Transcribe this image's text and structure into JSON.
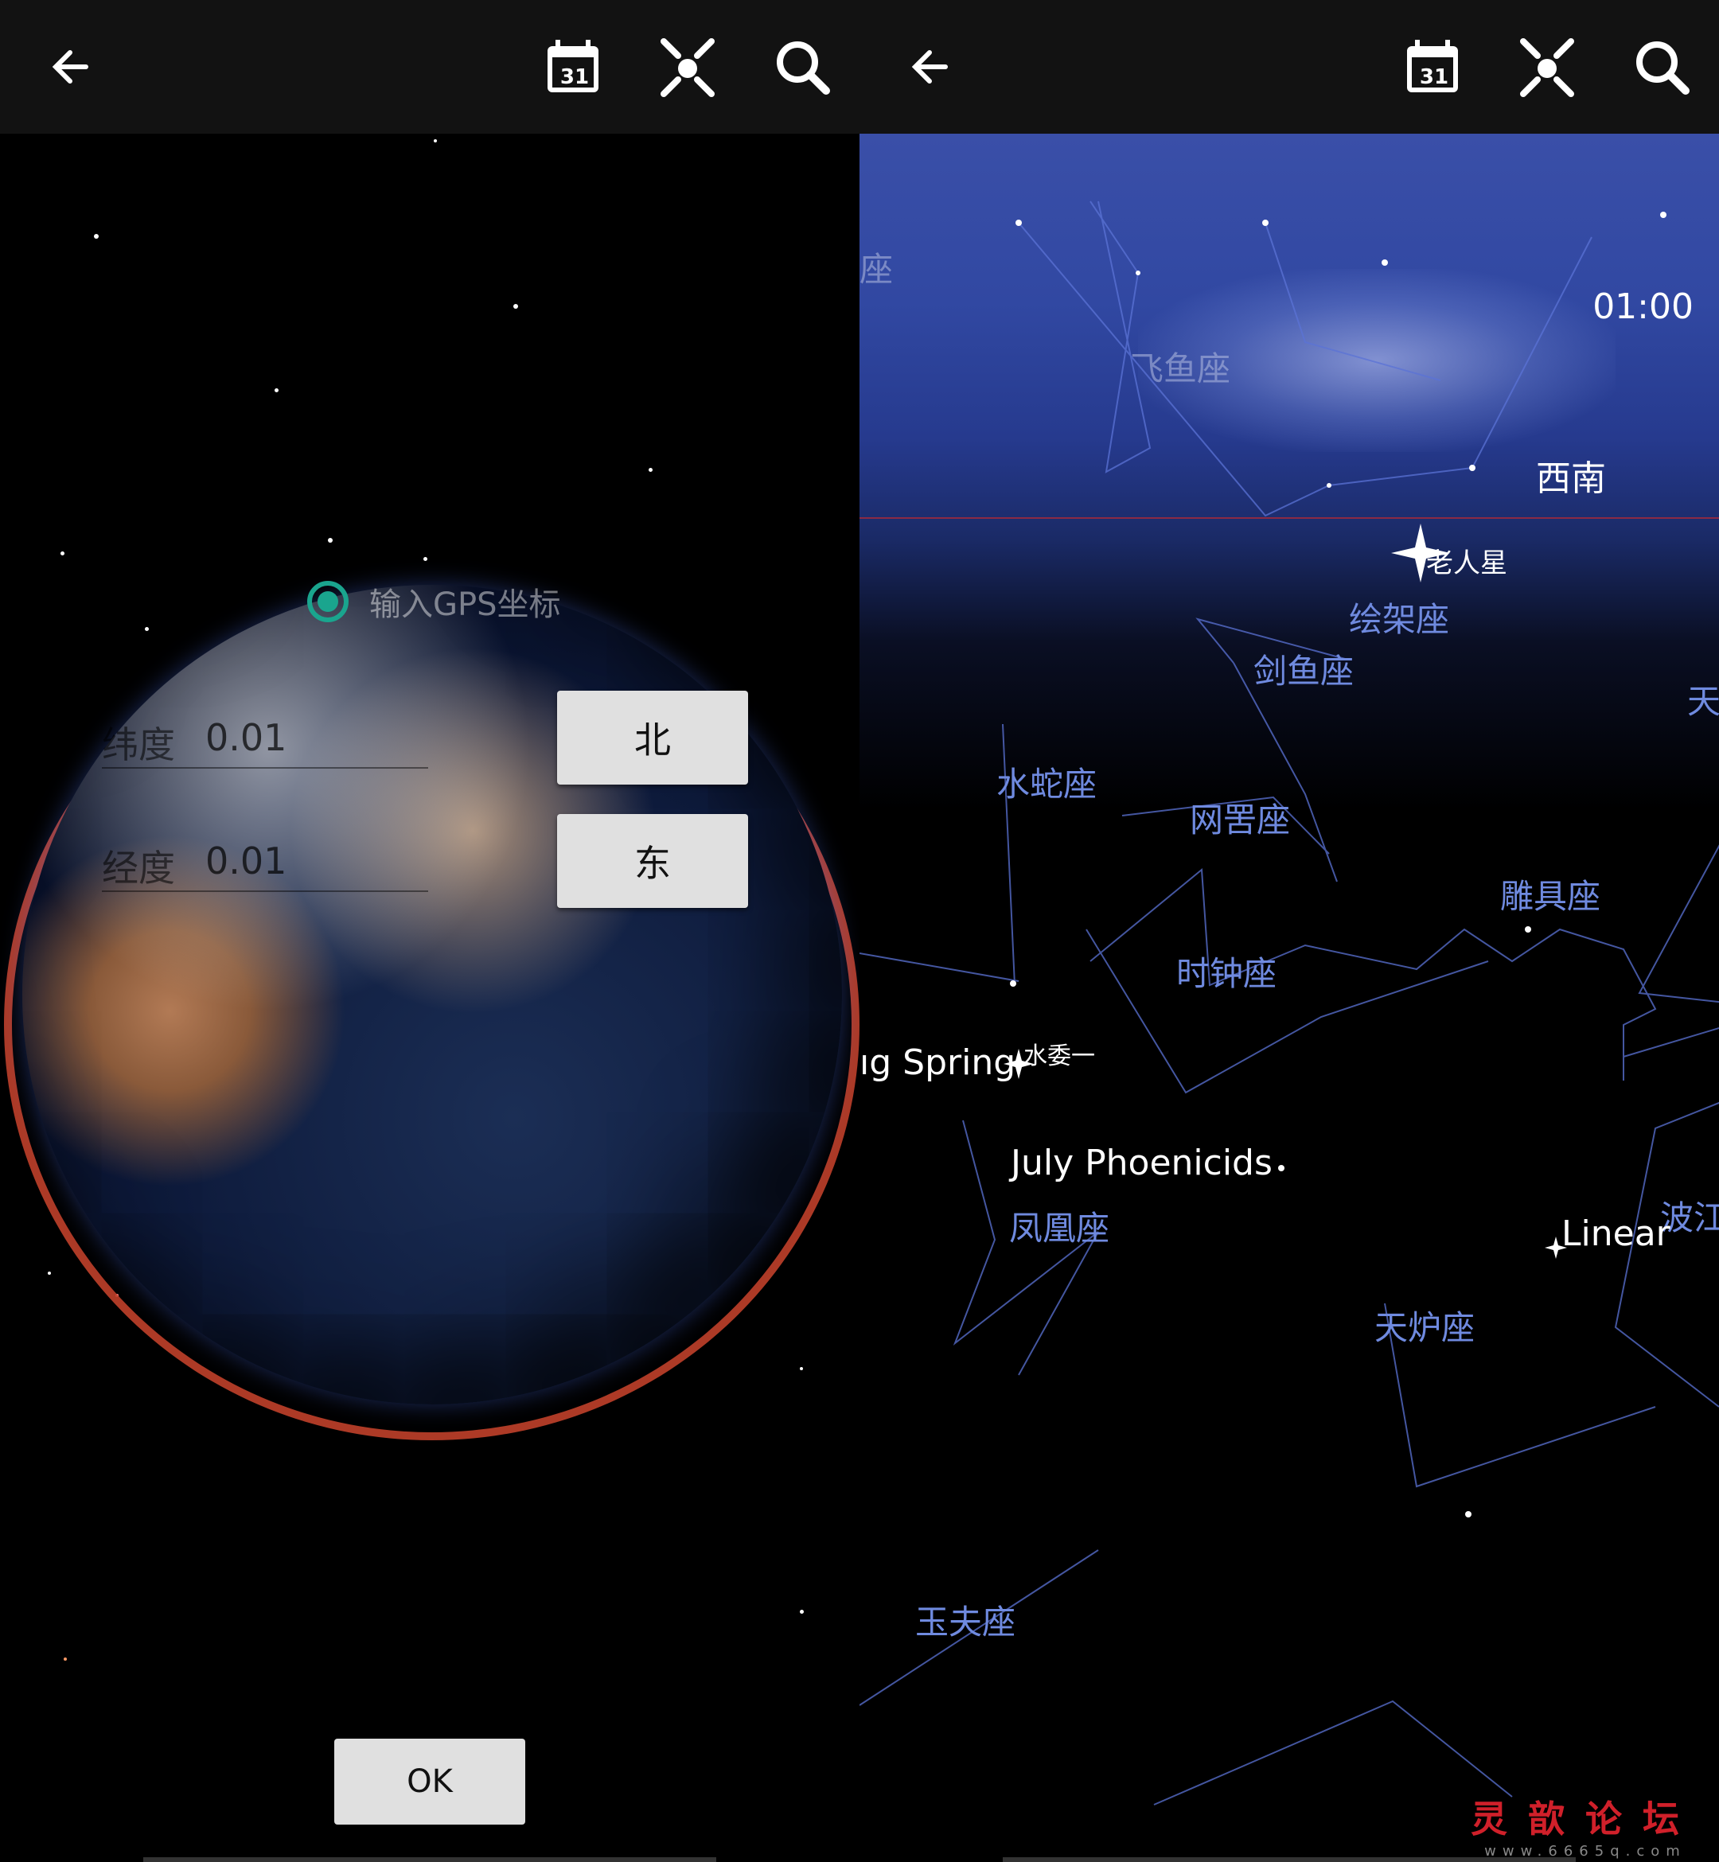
{
  "left": {
    "toolbar": {
      "back_icon": "arrow-left-icon",
      "calendar_icon": "calendar-31-icon",
      "location_icon": "location-target-icon",
      "search_icon": "search-icon",
      "calendar_text": "31"
    },
    "gps_label": "输入GPS坐标",
    "latitude": {
      "label": "纬度",
      "value": "0.01"
    },
    "longitude": {
      "label": "经度",
      "value": "0.01"
    },
    "north_button": "北",
    "east_button": "东",
    "ok_button": "OK"
  },
  "right": {
    "toolbar": {
      "back_icon": "arrow-left-icon",
      "calendar_icon": "calendar-31-icon",
      "location_icon": "location-target-icon",
      "search_icon": "search-icon",
      "calendar_text": "31"
    },
    "time": "01:00",
    "direction": "西南",
    "star_canopus": "老人星",
    "star_achernar": "水委一",
    "constellations": {
      "volans": "飞鱼座",
      "pictor": "绘架座",
      "dorado": "剑鱼座",
      "hydrus": "水蛇座",
      "reticulum": "网罟座",
      "caelum": "雕具座",
      "horologium": "时钟座",
      "phoenix": "凤凰座",
      "fornax": "天炉座",
      "tucana": "玉夫座",
      "edge_left": "座",
      "edge_right_top": "天",
      "edge_right_mid": "波江"
    },
    "meteors": {
      "spring": "ıg Spring",
      "phoenicids": "July Phoenicids",
      "linear": "Linear"
    },
    "watermark": {
      "logo": "灵歆论坛",
      "url": "www.6665q.com"
    }
  },
  "colors": {
    "accent": "#1aa58e",
    "orbit": "#c0402a",
    "constellation": "#6f8adf",
    "watermark": "#d0202a"
  }
}
